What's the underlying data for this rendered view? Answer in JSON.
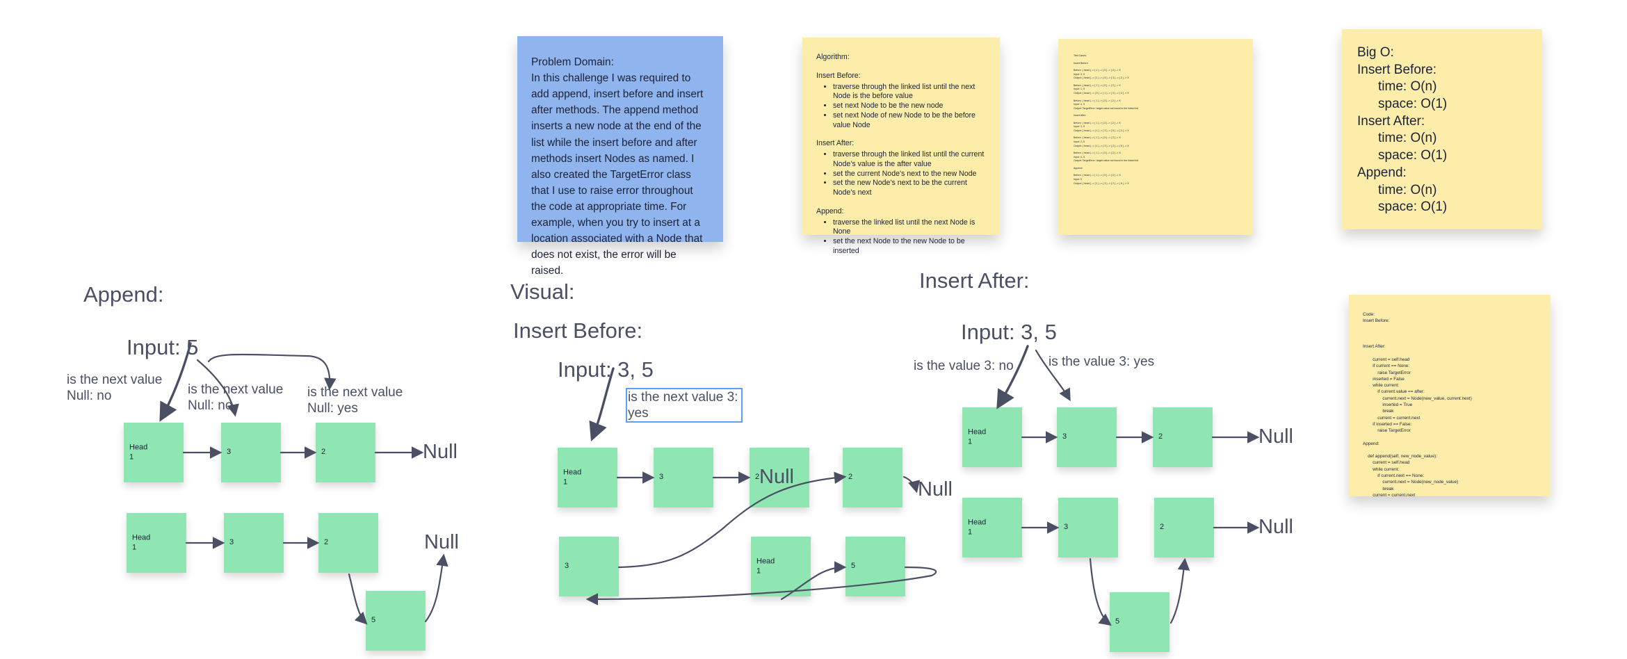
{
  "notes": {
    "problem_domain": {
      "heading": "Problem Domain:",
      "body": "In this challenge I was required to add append, insert before and insert after methods. The append method inserts a new node at the end of the list while the insert before and after methods insert Nodes as named. I also created the TargetError class that I use to raise error throughout the code at appropriate time. For example, when you try to insert at a location associated with a Node that does not exist, the error will be raised."
    },
    "algorithm": {
      "heading": "Algorithm:",
      "sections": [
        {
          "title": "Insert Before:",
          "items": [
            "traverse through the linked list until the next Node is the before value",
            "set next Node to be the new node",
            "set next Node of new Node to be the before value Node"
          ]
        },
        {
          "title": "Insert After:",
          "items": [
            "traverse through the linked list until the current Node's value is the after value",
            "set the current Node's next to the new Node",
            "set the new Node's next to be the current Node's next"
          ]
        },
        {
          "title": "Append:",
          "items": [
            "traverse the linked list until the next Node is None",
            "set the next Node to the new Node to be inserted"
          ]
        }
      ]
    },
    "tests": {
      "lines": [
        "Test Cases:",
        "",
        "Insert Before:",
        "",
        "Before: { head } -> { 1 } -> { 3 } -> { 2 } -> X",
        "Input: 3, 5",
        "Output: { head } -> { 1 } -> { 5 } -> { 3 } -> { 2 } -> X",
        "",
        "Before: { head } -> { 1 } -> { 3 } -> { 2 } -> X",
        "Input: 1, 5",
        "Output: { head } -> { 5 } -> { 1 } -> { 3 } -> { 2 } -> X",
        "",
        "Before: { head } -> { 1 } -> { 3 } -> { 2 } -> X",
        "Input: 4, 5",
        "Output: TargetError: target value not found in the linked list",
        "",
        "Insert After:",
        "",
        "Before: { head } -> { 1 } -> { 3 } -> { 2 } -> X",
        "Input: 3, 5",
        "Output: { head } -> { 1 } -> { 3 } -> { 5 } -> { 2 } -> X",
        "",
        "Before: { head } -> { 1 } -> { 3 } -> { 2 } -> X",
        "Input: 2, 5",
        "Output: { head } -> { 1 } -> { 3 } -> { 2 } -> { 5 } -> X",
        "",
        "Before: { head } -> { 1 } -> { 3 } -> { 2 } -> X",
        "Input: 4, 5",
        "Output: TargetError: target value not found in the linked list",
        "",
        "Append:",
        "",
        "Before: { head } -> { 1 } -> { 3 } -> { 2 } -> X",
        "Input: 5",
        "Output: { head } -> { 1 } -> { 3 } -> { 2 } -> { 5 } -> X"
      ]
    },
    "big_o": {
      "heading": "Big O:",
      "lines": [
        {
          "text": "Insert Before:",
          "indent": false
        },
        {
          "text": "time: O(n)",
          "indent": true
        },
        {
          "text": "space: O(1)",
          "indent": true
        },
        {
          "text": "Insert After:",
          "indent": false
        },
        {
          "text": "time: O(n)",
          "indent": true
        },
        {
          "text": "space: O(1)",
          "indent": true
        },
        {
          "text": "Append:",
          "indent": false
        },
        {
          "text": "time: O(n)",
          "indent": true
        },
        {
          "text": "space: O(1)",
          "indent": true
        }
      ]
    },
    "code": {
      "text": "Code:\nInsert Before:\n\n\n\nInsert After:\n\n        current = self.head\n        if current == None:\n            raise TargetError\n        inserted = False\n        while current:\n            if current.value == after:\n                current.next = Node(new_value, current.next)\n                inserted = True\n                break\n            current = current.next\n        if inserted == False:\n            raise TargetError\n\nAppend:\n\n    def append(self, new_node_value):\n        current = self.head\n        while current:\n            if current.next == None:\n                current.next = Node(new_node_value)\n                break\n        current = current.next"
    }
  },
  "sections": {
    "visual": "Visual:",
    "append": {
      "title": "Append:",
      "input": "Input: 5",
      "notes": [
        "is the next value\nNull: no",
        "is the next value\nNull: no",
        "is the next value\nNull: yes"
      ],
      "nodes_row1": [
        "Head\n1",
        "3",
        "2"
      ],
      "null1": "Null",
      "nodes_row2": [
        "Head\n1",
        "3",
        "2"
      ],
      "new_node": "5",
      "null2": "Null"
    },
    "insert_before": {
      "title": "Insert Before:",
      "input": "Input: 3, 5",
      "note": "is the next value 3:\nyes",
      "nodes_row1": [
        "Head\n1",
        "3",
        "2",
        "2"
      ],
      "null1": "Null",
      "overlay_null": "Null",
      "nodes_row2": [
        "3",
        "Head\n1",
        "5"
      ]
    },
    "insert_after": {
      "title": "Insert After:",
      "input": "Input: 3, 5",
      "notes": [
        "is the value 3: no",
        "is the value 3: yes"
      ],
      "nodes_row1": [
        "Head\n1",
        "3",
        "2"
      ],
      "null1": "Null",
      "nodes_row2": [
        "Head\n1",
        "3",
        "2"
      ],
      "new_node": "5",
      "null2": "Null"
    }
  },
  "colors": {
    "ink": "#4a4f63",
    "node": "#8fe6b2",
    "sticky_blue": "#8fb4ee",
    "sticky_yellow": "#fdedaa",
    "selection": "#5aa2f0"
  }
}
